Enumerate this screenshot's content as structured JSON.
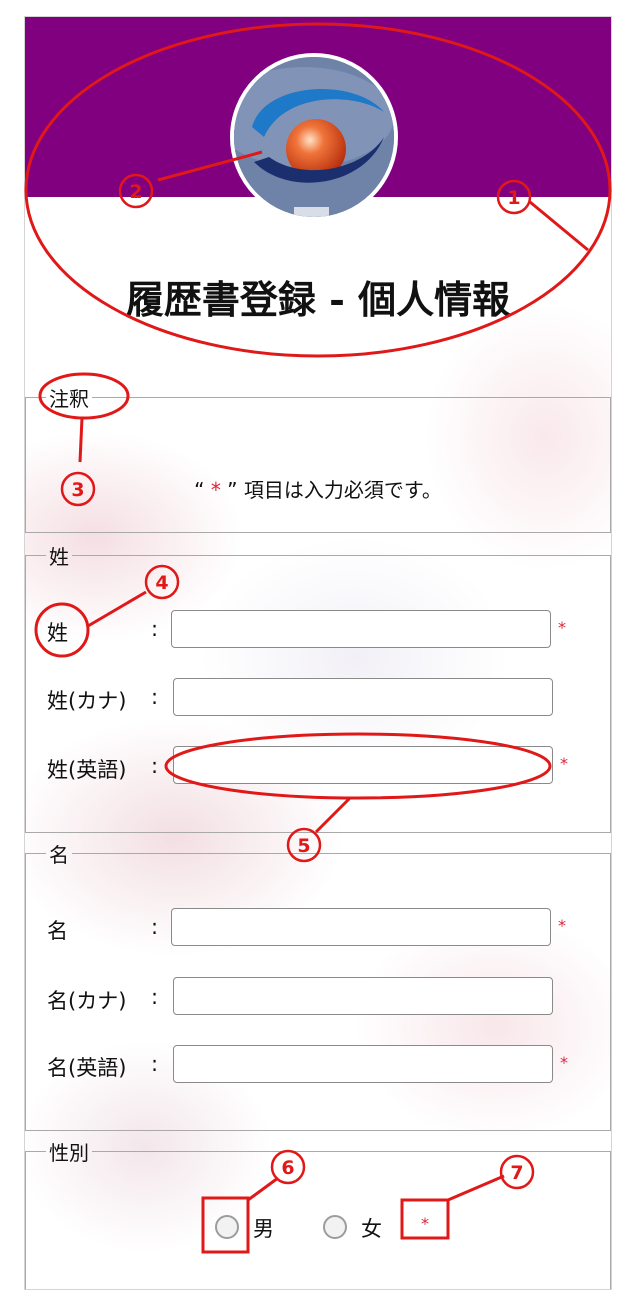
{
  "header": {
    "title": "履歴書登録 - 個人情報",
    "avatar_icon": "company-logo-icon",
    "banner_color": "#800080"
  },
  "note": {
    "legend": "注釈",
    "open_quote": "“",
    "star": "*",
    "close_quote": "”",
    "text": "項目は入力必須です。"
  },
  "surname": {
    "legend": "姓",
    "fields": [
      {
        "label": "姓",
        "value": "",
        "required": true
      },
      {
        "label": "姓(カナ)",
        "value": "",
        "required": false
      },
      {
        "label": "姓(英語)",
        "value": "",
        "required": true
      }
    ]
  },
  "given_name": {
    "legend": "名",
    "fields": [
      {
        "label": "名",
        "value": "",
        "required": true
      },
      {
        "label": "名(カナ)",
        "value": "",
        "required": false
      },
      {
        "label": "名(英語)",
        "value": "",
        "required": true
      }
    ]
  },
  "gender": {
    "legend": "性別",
    "options": [
      {
        "label": "男",
        "selected": false
      },
      {
        "label": "女",
        "selected": false
      }
    ],
    "required_mark": "*"
  },
  "common": {
    "colon": ":",
    "required_mark": "*"
  },
  "annotations": {
    "color": "#e01818",
    "markers": [
      "①",
      "②",
      "③",
      "④",
      "⑤",
      "⑥",
      "⑦"
    ]
  }
}
